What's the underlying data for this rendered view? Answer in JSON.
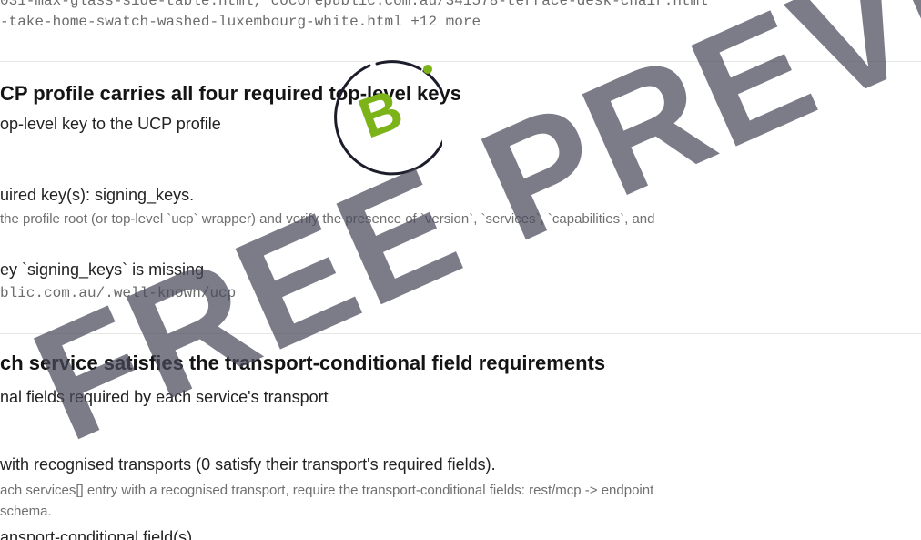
{
  "top_files": {
    "line1": "031-max-glass-side-table.html, cocorepublic.com.au/341578-terrace-desk-chair.html",
    "line2": "-take-home-swatch-washed-luxembourg-white.html +12 more"
  },
  "check1": {
    "title": "CP profile carries all four required top-level keys",
    "subtitle": "op-level key to the UCP profile",
    "result": "uired key(s): signing_keys.",
    "method": " the profile root (or top-level `ucp` wrapper) and verify the presence of `version`, `services`, `capabilities`, and",
    "finding": "ey `signing_keys` is missing",
    "url": "blic.com.au/.well-known/ucp"
  },
  "check2": {
    "title": "ch service satisfies the transport-conditional field requirements",
    "subtitle": "nal fields required by each service's transport",
    "result": "with recognised transports (0 satisfy their transport's required fields).",
    "method_line1": "ach services[] entry with a recognised transport, require the transport-conditional fields: rest/mcp -> endpoint",
    "method_line2": "schema.",
    "finding": "ansport-conditional field(s)"
  },
  "badge": {
    "letter": "B",
    "ring_color": "#1b1d2a",
    "accent_color": "#7cb318"
  },
  "watermark": {
    "text": "FREE PREVIEW"
  }
}
